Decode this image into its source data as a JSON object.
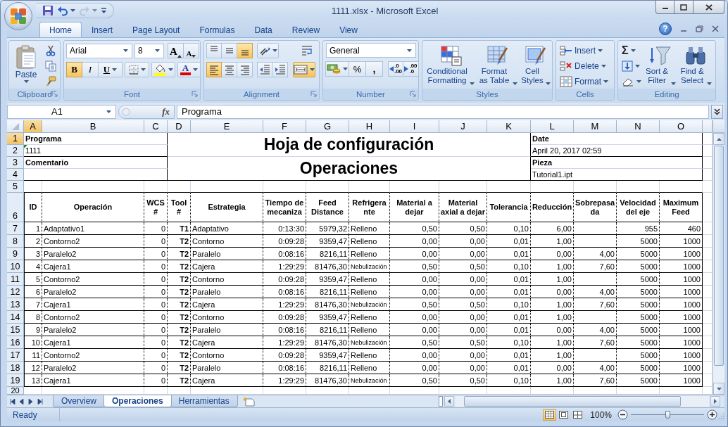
{
  "window": {
    "title": "1111.xlsx - Microsoft Excel"
  },
  "quick_access": [
    {
      "kind": "save",
      "disabled": false
    },
    {
      "kind": "undo",
      "disabled": false
    },
    {
      "kind": "redo",
      "disabled": true
    },
    {
      "kind": "customize",
      "disabled": false
    }
  ],
  "ribbon_tabs": [
    {
      "label": "Home",
      "selected": true
    },
    {
      "label": "Insert",
      "selected": false
    },
    {
      "label": "Page Layout",
      "selected": false
    },
    {
      "label": "Formulas",
      "selected": false
    },
    {
      "label": "Data",
      "selected": false
    },
    {
      "label": "Review",
      "selected": false
    },
    {
      "label": "View",
      "selected": false
    }
  ],
  "help": "?",
  "ribbon": {
    "groups": [
      {
        "kind": "clipboard",
        "label": "Clipboard",
        "launcher": true,
        "paste": "Paste"
      },
      {
        "kind": "font",
        "label": "Font",
        "launcher": true,
        "font_name": "Arial",
        "font_size": "8",
        "grow": "A",
        "shrink": "A",
        "bold": {
          "label": "B",
          "pressed": true
        },
        "italic": {
          "label": "I",
          "pressed": false
        },
        "underline": {
          "label": "U",
          "pressed": false
        },
        "font_color": "A"
      },
      {
        "kind": "alignment",
        "label": "Alignment",
        "launcher": true,
        "vertical": [
          {
            "kind": "top",
            "pressed": false
          },
          {
            "kind": "middle",
            "pressed": false
          },
          {
            "kind": "bottom",
            "pressed": true
          }
        ],
        "horizontal": [
          {
            "kind": "left",
            "pressed": true
          },
          {
            "kind": "center",
            "pressed": false
          },
          {
            "kind": "right",
            "pressed": false
          }
        ],
        "merge": {
          "pressed": true
        }
      },
      {
        "kind": "number",
        "label": "Number",
        "launcher": true,
        "format": "General",
        "percent": "%",
        "comma": ",",
        "decimals": [
          {
            "top": ".0",
            "bottom": ".00"
          },
          {
            "top": ".00",
            "bottom": ".0"
          }
        ]
      },
      {
        "kind": "styles",
        "label": "Styles",
        "launcher": false,
        "buttons": [
          {
            "kind": "conditional",
            "label": "Conditional Formatting"
          },
          {
            "kind": "table",
            "label": "Format as Table"
          },
          {
            "kind": "cellstyles",
            "label": "Cell Styles"
          }
        ]
      },
      {
        "kind": "cells",
        "label": "Cells",
        "launcher": false,
        "items": [
          {
            "kind": "insert",
            "label": "Insert"
          },
          {
            "kind": "delete",
            "label": "Delete"
          },
          {
            "kind": "format",
            "label": "Format"
          }
        ]
      },
      {
        "kind": "editing",
        "label": "Editing",
        "launcher": false,
        "sum": "Σ",
        "buttons": [
          {
            "kind": "sort",
            "label": "Sort & Filter"
          },
          {
            "kind": "find",
            "label": "Find & Select"
          }
        ]
      }
    ]
  },
  "formula_bar": {
    "name_box": "A1",
    "fx": "fx",
    "value": "Programa"
  },
  "sheet": {
    "columns": [
      {
        "label": "A",
        "selected": true
      },
      {
        "label": "B",
        "selected": false
      },
      {
        "label": "C",
        "selected": false
      },
      {
        "label": "D",
        "selected": false
      },
      {
        "label": "E",
        "selected": false
      },
      {
        "label": "F",
        "selected": false
      },
      {
        "label": "G",
        "selected": false
      },
      {
        "label": "H",
        "selected": false
      },
      {
        "label": "I",
        "selected": false
      },
      {
        "label": "J",
        "selected": false
      },
      {
        "label": "K",
        "selected": false
      },
      {
        "label": "L",
        "selected": false
      },
      {
        "label": "M",
        "selected": false
      },
      {
        "label": "N",
        "selected": false
      },
      {
        "label": "O",
        "selected": false
      }
    ],
    "row_headers": [
      {
        "label": "1",
        "selected": true
      },
      {
        "label": "2",
        "selected": false
      },
      {
        "label": "3",
        "selected": false
      },
      {
        "label": "4",
        "selected": false
      },
      {
        "label": "5",
        "selected": false
      },
      {
        "label": "6",
        "selected": false
      },
      {
        "label": "7",
        "selected": false
      },
      {
        "label": "8",
        "selected": false
      },
      {
        "label": "9",
        "selected": false
      },
      {
        "label": "10",
        "selected": false
      },
      {
        "label": "11",
        "selected": false
      },
      {
        "label": "12",
        "selected": false
      },
      {
        "label": "13",
        "selected": false
      },
      {
        "label": "14",
        "selected": false
      },
      {
        "label": "15",
        "selected": false
      },
      {
        "label": "16",
        "selected": false
      },
      {
        "label": "17",
        "selected": false
      },
      {
        "label": "18",
        "selected": false
      },
      {
        "label": "19",
        "selected": false
      },
      {
        "label": "20",
        "selected": false
      }
    ],
    "info": {
      "programa_label": "Programa",
      "programa_value": "1111",
      "programa_flag": true,
      "comentario_label": "Comentario",
      "title": "Hoja de configuración",
      "subtitle": "Operaciones",
      "date_label": "Date",
      "date_value": "April 20, 2017 02:59",
      "pieza_label": "Pieza",
      "pieza_value": "Tutorial1.ipt"
    },
    "table": {
      "headers": [
        "ID",
        "Operación",
        "WCS #",
        "Tool #",
        "Estrategia",
        "Tiempo de mecaniza",
        "Feed Distance",
        "Refrigerante",
        "Material a dejar",
        "Material axial a dejar",
        "Tolerancia",
        "Reducción",
        "Sobrepasada",
        "Velocidad del eje",
        "Maximum Feed"
      ],
      "rows": [
        {
          "id": "1",
          "operacion": "Adaptativo1",
          "wcs": "0",
          "tool": "T1",
          "estrategia": "Adaptativo",
          "tiempo": "0:13:30",
          "feed": "5979,32",
          "refrigerante": "Relleno",
          "material": "0,50",
          "material_axial": "0,50",
          "tolerancia": "0,10",
          "reduccion": "6,00",
          "velocidad": "955",
          "max_feed": "460"
        },
        {
          "id": "2",
          "operacion": "Contorno2",
          "wcs": "0",
          "tool": "T2",
          "estrategia": "Contorno",
          "tiempo": "0:09:28",
          "feed": "9359,47",
          "refrigerante": "Relleno",
          "material": "0,00",
          "material_axial": "0,00",
          "tolerancia": "0,01",
          "reduccion": "1,00",
          "velocidad": "5000",
          "max_feed": "1000"
        },
        {
          "id": "3",
          "operacion": "Paralelo2",
          "wcs": "0",
          "tool": "T2",
          "estrategia": "Paralelo",
          "tiempo": "0:08:16",
          "feed": "8216,11",
          "refrigerante": "Relleno",
          "material": "0,00",
          "material_axial": "0,00",
          "tolerancia": "0,01",
          "reduccion": "0,00",
          "sobrepasada": "4,00",
          "velocidad": "5000",
          "max_feed": "1000"
        },
        {
          "id": "4",
          "operacion": "Cajera1",
          "wcs": "0",
          "tool": "T2",
          "estrategia": "Cajera",
          "tiempo": "1:29:29",
          "feed": "81476,30",
          "refrigerante": "Nebulización",
          "material": "0,50",
          "material_axial": "0,50",
          "tolerancia": "0,10",
          "reduccion": "1,00",
          "sobrepasada": "7,60",
          "velocidad": "5000",
          "max_feed": "1000"
        },
        {
          "id": "5",
          "operacion": "Contorno2",
          "wcs": "0",
          "tool": "T2",
          "estrategia": "Contorno",
          "tiempo": "0:09:28",
          "feed": "9359,47",
          "refrigerante": "Relleno",
          "material": "0,00",
          "material_axial": "0,00",
          "tolerancia": "0,01",
          "reduccion": "1,00",
          "velocidad": "5000",
          "max_feed": "1000"
        },
        {
          "id": "6",
          "operacion": "Paralelo2",
          "wcs": "0",
          "tool": "T2",
          "estrategia": "Paralelo",
          "tiempo": "0:08:16",
          "feed": "8216,11",
          "refrigerante": "Relleno",
          "material": "0,00",
          "material_axial": "0,00",
          "tolerancia": "0,01",
          "reduccion": "0,00",
          "sobrepasada": "4,00",
          "velocidad": "5000",
          "max_feed": "1000"
        },
        {
          "id": "7",
          "operacion": "Cajera1",
          "wcs": "0",
          "tool": "T2",
          "estrategia": "Cajera",
          "tiempo": "1:29:29",
          "feed": "81476,30",
          "refrigerante": "Nebulización",
          "material": "0,50",
          "material_axial": "0,50",
          "tolerancia": "0,10",
          "reduccion": "1,00",
          "sobrepasada": "7,60",
          "velocidad": "5000",
          "max_feed": "1000"
        },
        {
          "id": "8",
          "operacion": "Contorno2",
          "wcs": "0",
          "tool": "T2",
          "estrategia": "Contorno",
          "tiempo": "0:09:28",
          "feed": "9359,47",
          "refrigerante": "Relleno",
          "material": "0,00",
          "material_axial": "0,00",
          "tolerancia": "0,01",
          "reduccion": "1,00",
          "velocidad": "5000",
          "max_feed": "1000"
        },
        {
          "id": "9",
          "operacion": "Paralelo2",
          "wcs": "0",
          "tool": "T2",
          "estrategia": "Paralelo",
          "tiempo": "0:08:16",
          "feed": "8216,11",
          "refrigerante": "Relleno",
          "material": "0,00",
          "material_axial": "0,00",
          "tolerancia": "0,01",
          "reduccion": "0,00",
          "sobrepasada": "4,00",
          "velocidad": "5000",
          "max_feed": "1000"
        },
        {
          "id": "10",
          "operacion": "Cajera1",
          "wcs": "0",
          "tool": "T2",
          "estrategia": "Cajera",
          "tiempo": "1:29:29",
          "feed": "81476,30",
          "refrigerante": "Nebulización",
          "material": "0,50",
          "material_axial": "0,50",
          "tolerancia": "0,10",
          "reduccion": "1,00",
          "sobrepasada": "7,60",
          "velocidad": "5000",
          "max_feed": "1000"
        },
        {
          "id": "11",
          "operacion": "Contorno2",
          "wcs": "0",
          "tool": "T2",
          "estrategia": "Contorno",
          "tiempo": "0:09:28",
          "feed": "9359,47",
          "refrigerante": "Relleno",
          "material": "0,00",
          "material_axial": "0,00",
          "tolerancia": "0,01",
          "reduccion": "1,00",
          "velocidad": "5000",
          "max_feed": "1000"
        },
        {
          "id": "12",
          "operacion": "Paralelo2",
          "wcs": "0",
          "tool": "T2",
          "estrategia": "Paralelo",
          "tiempo": "0:08:16",
          "feed": "8216,11",
          "refrigerante": "Relleno",
          "material": "0,00",
          "material_axial": "0,00",
          "tolerancia": "0,01",
          "reduccion": "0,00",
          "sobrepasada": "4,00",
          "velocidad": "5000",
          "max_feed": "1000"
        },
        {
          "id": "13",
          "operacion": "Cajera1",
          "wcs": "0",
          "tool": "T2",
          "estrategia": "Cajera",
          "tiempo": "1:29:29",
          "feed": "81476,30",
          "refrigerante": "Nebulización",
          "material": "0,50",
          "material_axial": "0,50",
          "tolerancia": "0,10",
          "reduccion": "1,00",
          "sobrepasada": "7,60",
          "velocidad": "5000",
          "max_feed": "1000"
        }
      ]
    }
  },
  "sheet_tabs": [
    {
      "label": "Overview",
      "selected": false
    },
    {
      "label": "Operaciones",
      "selected": true
    },
    {
      "label": "Herramientas",
      "selected": false
    }
  ],
  "status_bar": {
    "status": "Ready",
    "views": [
      {
        "kind": "normal",
        "selected": true
      },
      {
        "kind": "page_layout",
        "selected": false
      },
      {
        "kind": "page_break",
        "selected": false
      }
    ],
    "zoom": {
      "label": "100%",
      "level": 0.5
    }
  }
}
